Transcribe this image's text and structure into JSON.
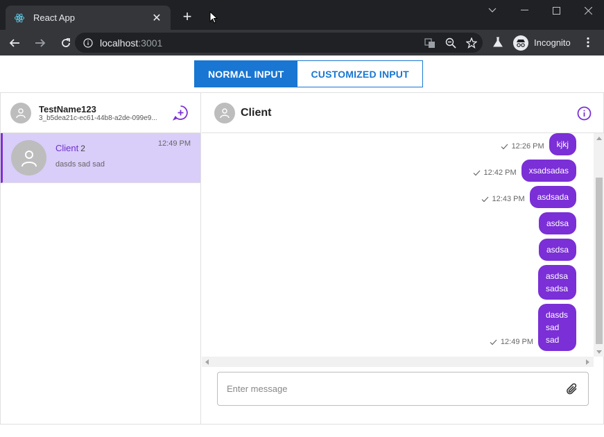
{
  "browser": {
    "tab_title": "React App",
    "url_host": "localhost",
    "url_port": ":3001",
    "profile_label": "Incognito"
  },
  "toggle": {
    "normal_label": "NORMAL INPUT",
    "custom_label": "CUSTOMIZED INPUT"
  },
  "sidebar": {
    "user_name": "TestName123",
    "user_id": "3_b5dea21c-ec61-44b8-a2de-099e9...",
    "conversation": {
      "name": "Client",
      "count": "2",
      "last_message": "dasds sad sad",
      "time": "12:49 PM"
    }
  },
  "main": {
    "title": "Client",
    "messages": [
      {
        "text": "kjkj",
        "time": "12:26 PM"
      },
      {
        "text": "xsadsadas",
        "time": "12:42 PM"
      },
      {
        "text": "asdsada",
        "time": "12:43 PM"
      },
      {
        "text": "asdsa",
        "time": ""
      },
      {
        "text": "asdsa",
        "time": ""
      },
      {
        "text": "asdsa sadsa",
        "time": ""
      },
      {
        "text": "dasds sad sad",
        "time": "12:49 PM"
      }
    ],
    "input_placeholder": "Enter message"
  },
  "colors": {
    "accent": "#7b2fd6",
    "primary": "#1976d2",
    "selected_bg": "#d9cdf9"
  }
}
